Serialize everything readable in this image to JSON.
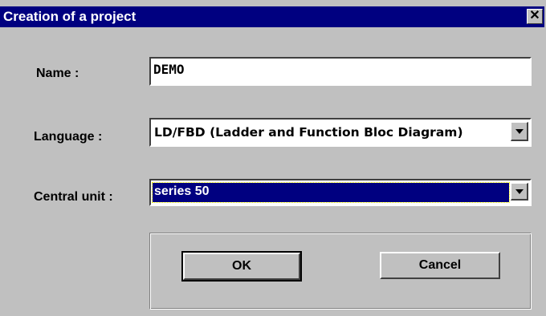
{
  "dialog": {
    "title": "Creation of a project",
    "close_glyph": "✕"
  },
  "form": {
    "name_label": "Name :",
    "name_value": "DEMO",
    "language_label": "Language :",
    "language_value": "LD/FBD (Ladder and Function Bloc Diagram)",
    "central_unit_label": "Central unit :",
    "central_unit_value": "series 50"
  },
  "buttons": {
    "ok_label": "OK",
    "cancel_label": "Cancel"
  },
  "icons": {
    "close": "close-icon",
    "dropdown": "chevron-down-icon"
  },
  "colors": {
    "titlebar": "#000080",
    "face": "#c0c0c0",
    "selection": "#000080"
  }
}
